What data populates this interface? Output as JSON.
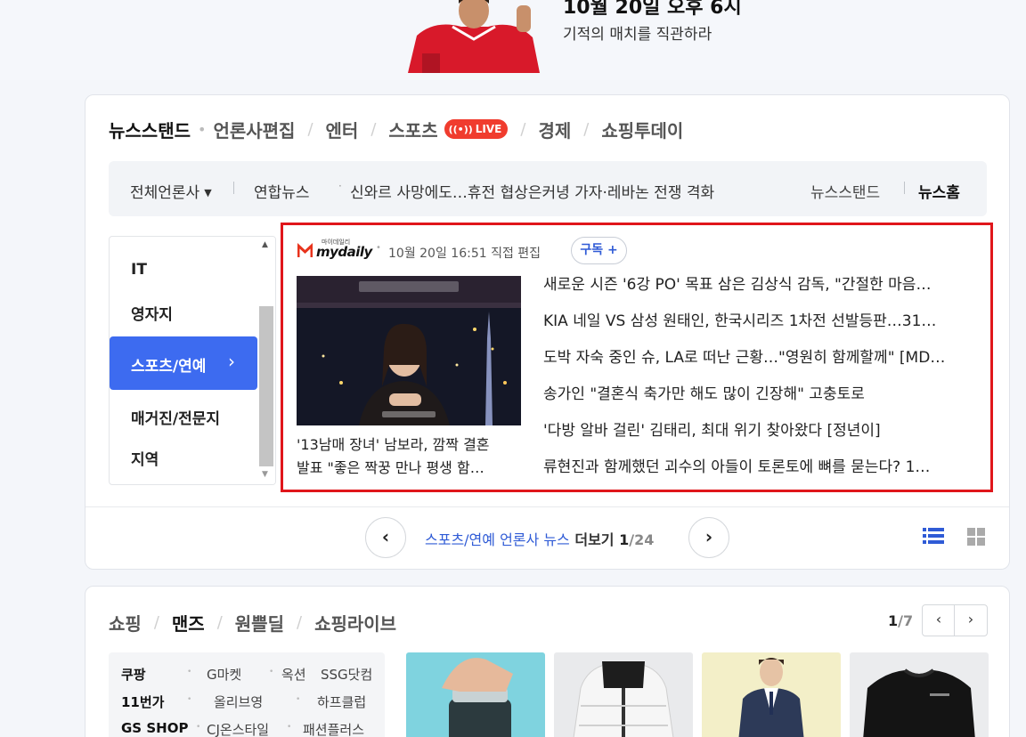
{
  "banner": {
    "title": "10월 20일 오후 6시",
    "subtitle": "기적의 매치를 직관하라"
  },
  "news_tabs": [
    {
      "label": "뉴스스탠드",
      "active": true
    },
    {
      "label": "언론사편집",
      "active": false
    },
    {
      "label": "엔터",
      "active": false
    },
    {
      "label": "스포츠",
      "active": false,
      "badge": "LIVE"
    },
    {
      "label": "경제",
      "active": false
    },
    {
      "label": "쇼핑투데이",
      "active": false
    }
  ],
  "press_bar": {
    "all_press": "전체언론사",
    "headline_press": "연합뉴스",
    "headline": "신와르 사망에도…휴전 협상은커녕 가자·레바논 전쟁 격화",
    "link_standard": "뉴스스탠드",
    "link_home": "뉴스홈"
  },
  "categories": {
    "items": [
      "IT",
      "영자지",
      "스포츠/연예",
      "매거진/전문지",
      "지역"
    ],
    "active": "스포츠/연예"
  },
  "news_panel": {
    "press_name": "mydaily",
    "press_tagline": "마이데일리",
    "meta": "10월 20일 16:51 직접 편집",
    "subscribe_label": "구독",
    "subscribe_plus": "+",
    "thumb_caption_line1": "'13남매 장녀' 남보라, 깜짝 결혼",
    "thumb_caption_line2": "발표 \"좋은 짝꿍 만나 평생 함…",
    "headlines": [
      "새로운 시즌 '6강 PO' 목표 삼은 김상식 감독, \"간절한 마음…",
      "KIA 네일 VS 삼성 원태인, 한국시리즈 1차전 선발등판…31…",
      "도박 자숙 중인 슈, LA로 떠난 근황…\"영원히 함께할께\" [MD…",
      "송가인 \"결혼식 축가만 해도 많이 긴장해\" 고충토로",
      "'다방 알바 걸린' 김태리, 최대 위기 찾아왔다 [정년이]",
      "류현진과 함께했던 괴수의 아들이 토론토에 뼈를 묻는다? 1…"
    ]
  },
  "pager": {
    "link": "스포츠/연예 언론사 뉴스",
    "more": "더보기",
    "current": "1",
    "total": "/24"
  },
  "shopping": {
    "tabs": [
      {
        "label": "쇼핑",
        "active": false
      },
      {
        "label": "맨즈",
        "active": true
      },
      {
        "label": "원쁠딜",
        "active": false
      },
      {
        "label": "쇼핑라이브",
        "active": false
      }
    ],
    "page_current": "1",
    "page_total": "/7",
    "malls": [
      "쿠팡",
      "G마켓",
      "옥션",
      "SSG닷컴",
      "11번가",
      "올리브영",
      "하프클럽",
      "GS SHOP",
      "CJ온스타일",
      "패션플러스"
    ]
  },
  "colors": {
    "accent": "#3d6bf0",
    "live": "#f03c2e",
    "highlight_border": "#e0161b",
    "link_blue": "#2f5bd6"
  },
  "icons": [
    "caret-down-icon",
    "chevron-right-icon",
    "chevron-left-icon",
    "live-broadcast-icon",
    "list-view-icon",
    "grid-view-icon",
    "scroll-up-icon",
    "scroll-down-icon"
  ]
}
